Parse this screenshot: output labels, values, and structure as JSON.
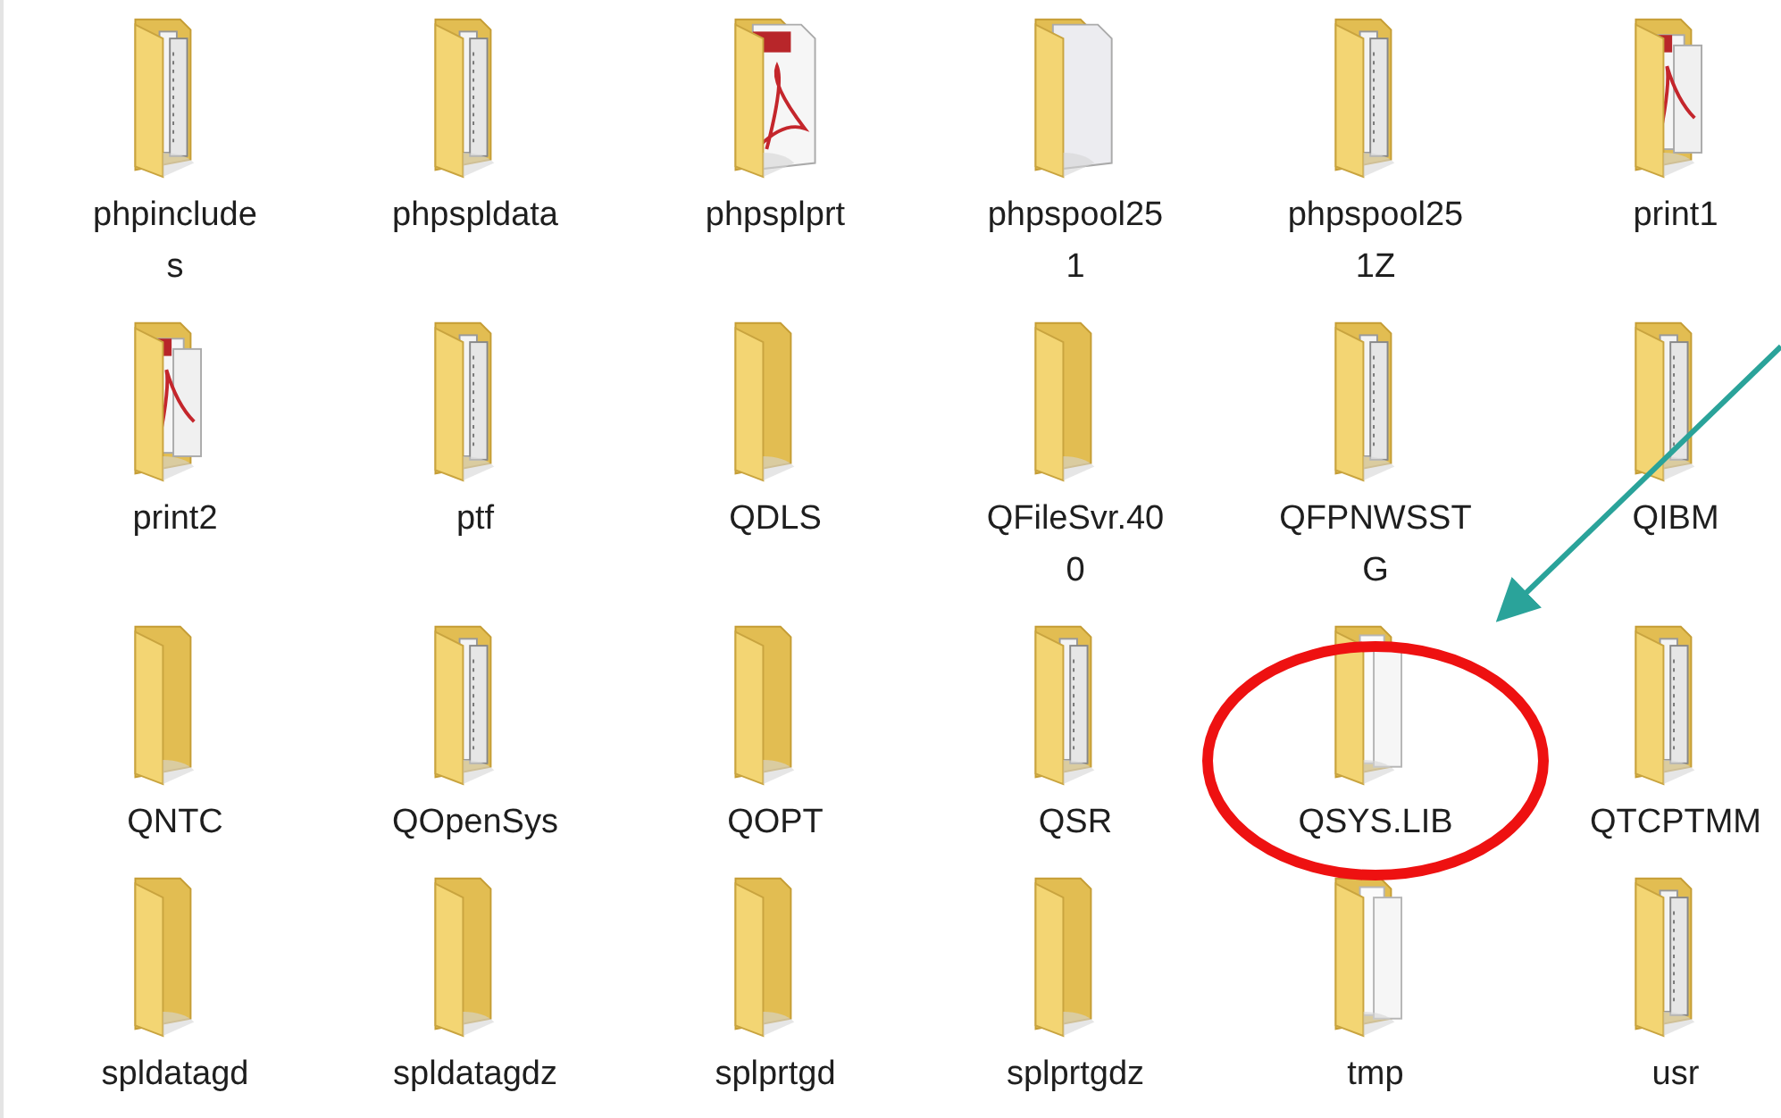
{
  "items": [
    {
      "label_lines": [
        "phpinclude",
        "s"
      ],
      "kind": "papers"
    },
    {
      "label_lines": [
        "phpspldata"
      ],
      "kind": "papers"
    },
    {
      "label_lines": [
        "phpsplprt"
      ],
      "kind": "pdf"
    },
    {
      "label_lines": [
        "phpspool25",
        "1"
      ],
      "kind": "page"
    },
    {
      "label_lines": [
        "phpspool25",
        "1Z"
      ],
      "kind": "papers"
    },
    {
      "label_lines": [
        "print1"
      ],
      "kind": "prints"
    },
    {
      "label_lines": [
        "print2"
      ],
      "kind": "prints"
    },
    {
      "label_lines": [
        "ptf"
      ],
      "kind": "papers"
    },
    {
      "label_lines": [
        "QDLS"
      ],
      "kind": "empty"
    },
    {
      "label_lines": [
        "QFileSvr.40",
        "0"
      ],
      "kind": "empty"
    },
    {
      "label_lines": [
        "QFPNWSST",
        "G"
      ],
      "kind": "papers"
    },
    {
      "label_lines": [
        "QIBM"
      ],
      "kind": "papers"
    },
    {
      "label_lines": [
        "QNTC"
      ],
      "kind": "empty"
    },
    {
      "label_lines": [
        "QOpenSys"
      ],
      "kind": "papers"
    },
    {
      "label_lines": [
        "QOPT"
      ],
      "kind": "empty"
    },
    {
      "label_lines": [
        "QSR"
      ],
      "kind": "papers"
    },
    {
      "label_lines": [
        "QSYS.LIB"
      ],
      "kind": "white"
    },
    {
      "label_lines": [
        "QTCPTMM"
      ],
      "kind": "papers"
    },
    {
      "label_lines": [
        "spldatagd"
      ],
      "kind": "empty"
    },
    {
      "label_lines": [
        "spldatagdz"
      ],
      "kind": "empty"
    },
    {
      "label_lines": [
        "splprtgd"
      ],
      "kind": "empty"
    },
    {
      "label_lines": [
        "splprtgdz"
      ],
      "kind": "empty"
    },
    {
      "label_lines": [
        "tmp"
      ],
      "kind": "white"
    },
    {
      "label_lines": [
        "usr"
      ],
      "kind": "papers"
    }
  ]
}
